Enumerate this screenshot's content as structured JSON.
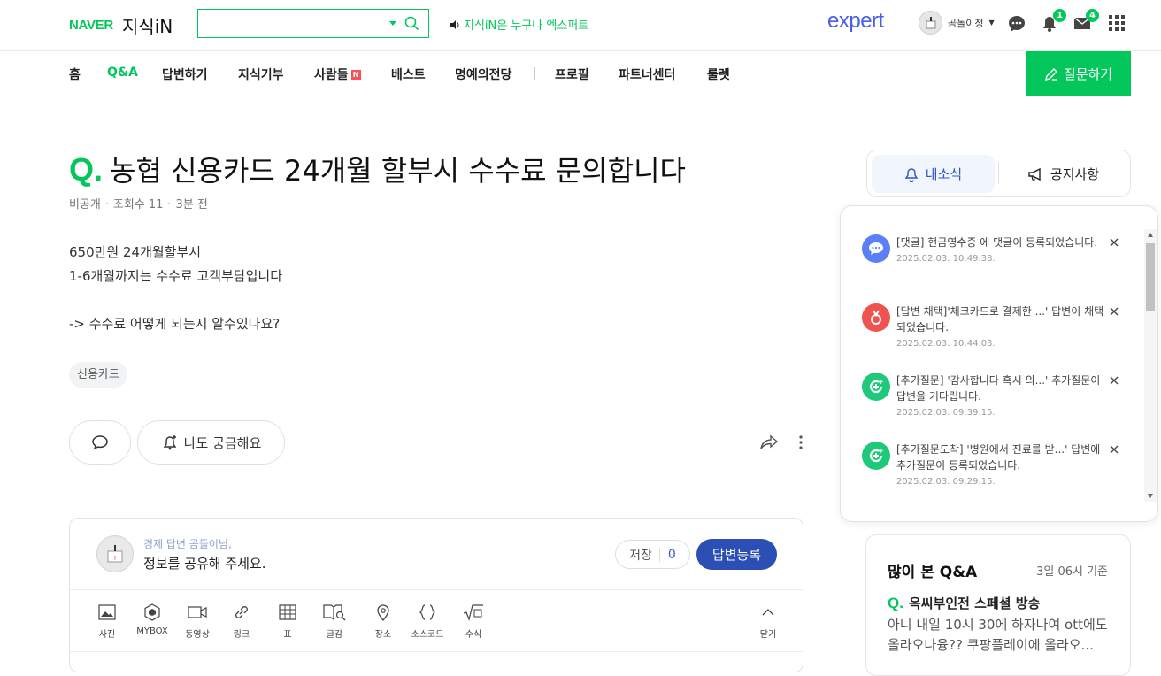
{
  "header": {
    "logo_naver": "NAVER",
    "logo_kin": "지식iN",
    "search_placeholder": "",
    "promo": "지식iN은 누구나 엑스퍼트",
    "expert": "expert",
    "user_name": "곰돌이정",
    "alarm_count": "1",
    "mail_count": "4"
  },
  "nav": {
    "items": [
      "홈",
      "Q&A",
      "답변하기",
      "지식기부",
      "사람들",
      "베스트",
      "명예의전당",
      "프로필",
      "파트너센터",
      "룰렛"
    ],
    "people_badge": "N",
    "ask_button": "질문하기"
  },
  "question": {
    "q_mark": "Q.",
    "title": "농협 신용카드 24개월 할부시 수수료 문의합니다",
    "author": "비공개",
    "views": "조회수 11",
    "time": "3분 전",
    "body": [
      "650만원 24개월할부시",
      "1-6개월까지는 수수료 고객부담입니다",
      "",
      "-> 수수료 어떻게 되는지 알수있나요?"
    ],
    "tag": "신용카드",
    "curious_button": "나도 궁금해요"
  },
  "answer_box": {
    "subtitle": "경제 답변 곰돌이님,",
    "prompt": "정보를 공유해 주세요.",
    "save_label": "저장",
    "save_count": "0",
    "register_label": "답변등록",
    "toolbar": [
      "사진",
      "MYBOX",
      "동영상",
      "링크",
      "표",
      "글감",
      "장소",
      "소스코드",
      "수식"
    ],
    "close_label": "닫기"
  },
  "side_tabs": {
    "news": "내소식",
    "notice": "공지사항"
  },
  "notifications": [
    {
      "text": "[댓글] 현금영수증 에 댓글이 등록되었습니다.",
      "time": "2025.02.03. 10:49:38.",
      "icon": "comment-icon",
      "color": "#5b7ff5"
    },
    {
      "text": "[답변 채택]'체크카드로 결제한 ...' 답변이 채택되었습니다.",
      "time": "2025.02.03. 10:44:03.",
      "icon": "ribbon-icon",
      "color": "#ef5350"
    },
    {
      "text": "[추가질문] '감사합니다 혹시 의...' 추가질문이 답변을 기다립니다.",
      "time": "2025.02.03. 09:39:15.",
      "icon": "followup-icon",
      "color": "#1ec97a"
    },
    {
      "text": "[추가질문도착] '병원에서 진료를 받...' 답변에 추가질문이 등록되었습니다.",
      "time": "2025.02.03. 09:29:15.",
      "icon": "followup-icon",
      "color": "#1ec97a"
    }
  ],
  "popular": {
    "title": "많이 본 Q&A",
    "date": "3일 06시 기준",
    "q_mark": "Q.",
    "question": "옥씨부인전 스페셜 방송",
    "excerpt_1": "아니 내일 10시 30에 하자나여 ott에도",
    "excerpt_2": "올라오나융?? 쿠팡플레이에 올라오..."
  }
}
